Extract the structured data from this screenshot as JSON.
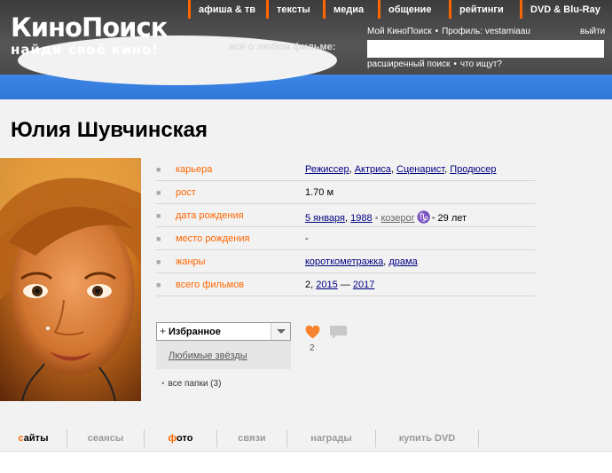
{
  "header": {
    "logo_title": "КиноПоиск",
    "logo_subtitle": "найди своё кино!",
    "nav": [
      "афиша & тв",
      "тексты",
      "медиа",
      "общение",
      "рейтинги",
      "DVD & Blu-Ray"
    ],
    "search_label": "всё о любом фильме:",
    "my_kinopoisk": "Мой КиноПоиск",
    "profile": "Профиль: vestamiaau",
    "exit": "выйти",
    "search_value": "",
    "advanced_search": "расширенный поиск",
    "what_searched": "что ищут?",
    "accent_color": "#ff6600",
    "band_color": "#3a83e2"
  },
  "person": {
    "name": "Юлия Шувчинская"
  },
  "info": {
    "career": {
      "label": "карьера",
      "values": [
        "Режиссер",
        "Актриса",
        "Сценарист",
        "Продюсер"
      ]
    },
    "height": {
      "label": "рост",
      "value": "1.70 м"
    },
    "birth": {
      "label": "дата рождения",
      "date": "5 января",
      "year": "1988",
      "zodiac": "козерог",
      "zodiac_icon": "capricorn-icon",
      "age": "29 лет"
    },
    "birthplace": {
      "label": "место рождения",
      "value": "-"
    },
    "genres": {
      "label": "жанры",
      "values": [
        "короткометражка",
        "драма"
      ]
    },
    "films": {
      "label": "всего фильмов",
      "count": "2,",
      "from": "2015",
      "dash": "—",
      "to": "2017"
    }
  },
  "favorites": {
    "selected": "Избранное",
    "option": "Любимые звёзды",
    "all_folders": "все папки (3)",
    "likes": "2"
  },
  "tabs": [
    {
      "prefix": "с",
      "rest": "айты"
    },
    {
      "prefix": "",
      "rest": "сеансы"
    },
    {
      "prefix": "ф",
      "rest": "ото"
    },
    {
      "prefix": "",
      "rest": "связи"
    },
    {
      "prefix": "",
      "rest": "награды"
    },
    {
      "prefix": "",
      "rest": "купить DVD"
    }
  ]
}
